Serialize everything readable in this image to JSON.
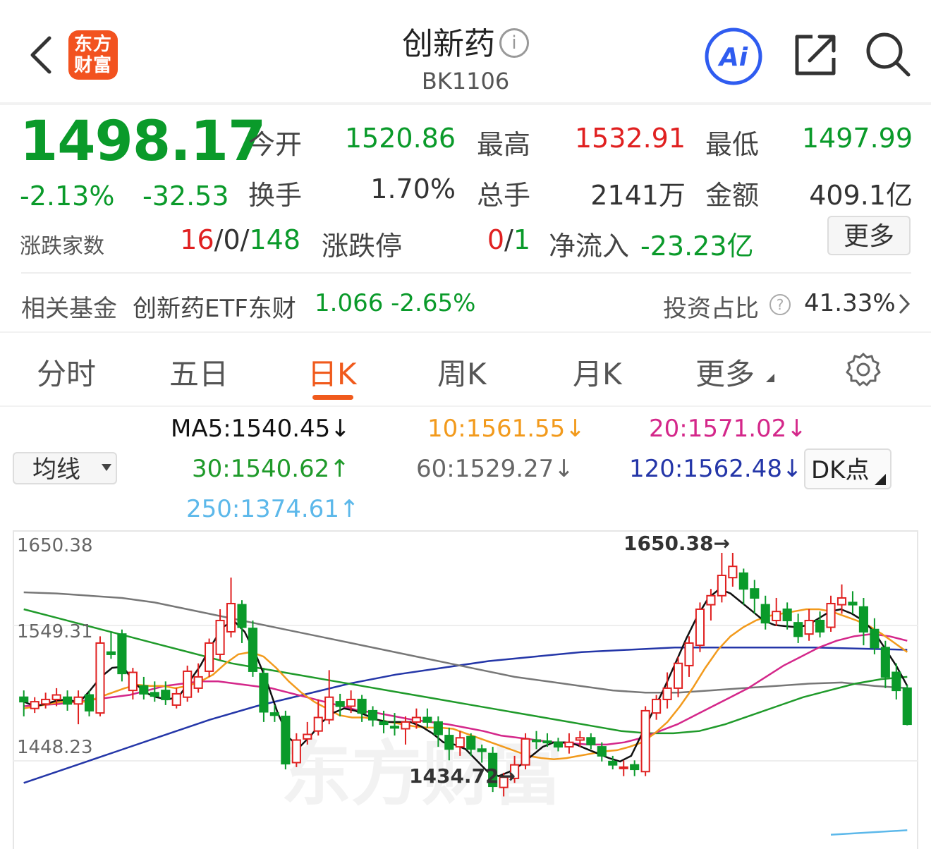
{
  "header": {
    "title": "创新药",
    "code": "BK1106",
    "logo_line1": "东方",
    "logo_line2": "财富",
    "info_glyph": "i",
    "ai_label": "Ai"
  },
  "quote": {
    "price": "1498.17",
    "change_pct": "-2.13%",
    "change": "-32.53",
    "open_label": "今开",
    "open": "1520.86",
    "high_label": "最高",
    "high": "1532.91",
    "low_label": "最低",
    "low": "1497.99",
    "turnover_label": "换手",
    "turnover": "1.70%",
    "volume_label": "总手",
    "volume": "2141万",
    "amount_label": "金额",
    "amount": "409.1亿",
    "breadth_label": "涨跌家数",
    "breadth_up": "16",
    "breadth_flat": "0",
    "breadth_down": "148",
    "limit_label": "涨跌停",
    "limit_up": "0",
    "limit_down": "1",
    "netflow_label": "净流入",
    "netflow": "-23.23亿",
    "more_label": "更多"
  },
  "fund": {
    "label": "相关基金",
    "name": "创新药ETF东财",
    "price": "1.066",
    "change": "-2.65%",
    "ratio_label": "投资占比",
    "ratio": "41.33%"
  },
  "tabs": [
    {
      "label": "分时"
    },
    {
      "label": "五日"
    },
    {
      "label": "日K"
    },
    {
      "label": "周K"
    },
    {
      "label": "月K"
    },
    {
      "label": "更多"
    }
  ],
  "ma": {
    "ma5": "MA5:1540.45↓",
    "ma10": "10:1561.55↓",
    "ma20": "20:1571.02↓",
    "ma30": "30:1540.62↑",
    "ma60": "60:1529.27↓",
    "ma120": "120:1562.48↓",
    "ma250": "250:1374.61↑",
    "select_label": "均线",
    "dk_label": "DK点"
  },
  "colors": {
    "up": "#e02020",
    "down": "#0a9a2a",
    "ma5": "#111111",
    "ma10": "#f29a1c",
    "ma20": "#d4278a",
    "ma30": "#1f9a2a",
    "ma60": "#777777",
    "ma120": "#2436a8",
    "ma250": "#5cb8ea",
    "accent": "#f05a1c"
  },
  "chart_data": {
    "type": "candlestick",
    "y_ticks": [
      "1650.38",
      "1549.31",
      "1448.23"
    ],
    "ylim": [
      1400,
      1660
    ],
    "max_label": "1650.38→",
    "min_label": "1434.72→",
    "watermark": "东方财富",
    "candles": [
      [
        1522,
        1518,
        1528,
        1505
      ],
      [
        1512,
        1518,
        1522,
        1508
      ],
      [
        1516,
        1520,
        1526,
        1512
      ],
      [
        1520,
        1524,
        1530,
        1514
      ],
      [
        1522,
        1516,
        1528,
        1510
      ],
      [
        1516,
        1522,
        1528,
        1498
      ],
      [
        1524,
        1510,
        1528,
        1505
      ],
      [
        1508,
        1570,
        1576,
        1505
      ],
      [
        1562,
        1560,
        1580,
        1556
      ],
      [
        1578,
        1543,
        1582,
        1536
      ],
      [
        1528,
        1544,
        1548,
        1520
      ],
      [
        1532,
        1525,
        1540,
        1520
      ],
      [
        1526,
        1523,
        1536,
        1518
      ],
      [
        1528,
        1520,
        1536,
        1515
      ],
      [
        1515,
        1525,
        1530,
        1512
      ],
      [
        1522,
        1545,
        1550,
        1518
      ],
      [
        1530,
        1540,
        1552,
        1526
      ],
      [
        1545,
        1570,
        1574,
        1540
      ],
      [
        1560,
        1590,
        1600,
        1555
      ],
      [
        1580,
        1605,
        1628,
        1575
      ],
      [
        1604,
        1584,
        1608,
        1570
      ],
      [
        1583,
        1545,
        1590,
        1540
      ],
      [
        1543,
        1509,
        1548,
        1500
      ],
      [
        1508,
        1506,
        1515,
        1500
      ],
      [
        1505,
        1463,
        1510,
        1458
      ],
      [
        1464,
        1484,
        1490,
        1460
      ],
      [
        1485,
        1489,
        1500,
        1480
      ],
      [
        1492,
        1504,
        1520,
        1488
      ],
      [
        1502,
        1522,
        1546,
        1498
      ],
      [
        1518,
        1514,
        1525,
        1505
      ],
      [
        1514,
        1520,
        1528,
        1508
      ],
      [
        1520,
        1508,
        1524,
        1500
      ],
      [
        1510,
        1502,
        1514,
        1496
      ],
      [
        1500,
        1498,
        1510,
        1490
      ],
      [
        1496,
        1495,
        1508,
        1488
      ],
      [
        1494,
        1500,
        1505,
        1480
      ],
      [
        1500,
        1504,
        1512,
        1494
      ],
      [
        1504,
        1500,
        1512,
        1495
      ],
      [
        1500,
        1489,
        1505,
        1478
      ],
      [
        1488,
        1476,
        1495,
        1466
      ],
      [
        1478,
        1486,
        1492,
        1470
      ],
      [
        1487,
        1476,
        1490,
        1470
      ],
      [
        1476,
        1474,
        1480,
        1464
      ],
      [
        1472,
        1443,
        1478,
        1438
      ],
      [
        1442,
        1451,
        1455,
        1434
      ],
      [
        1450,
        1462,
        1470,
        1446
      ],
      [
        1462,
        1485,
        1490,
        1458
      ],
      [
        1484,
        1483,
        1492,
        1476
      ],
      [
        1483,
        1482,
        1490,
        1478
      ],
      [
        1482,
        1478,
        1486,
        1474
      ],
      [
        1478,
        1482,
        1490,
        1472
      ],
      [
        1484,
        1486,
        1492,
        1478
      ],
      [
        1486,
        1480,
        1490,
        1476
      ],
      [
        1478,
        1470,
        1482,
        1465
      ],
      [
        1465,
        1462,
        1470,
        1458
      ],
      [
        1460,
        1460,
        1466,
        1452
      ],
      [
        1462,
        1458,
        1466,
        1452
      ],
      [
        1456,
        1510,
        1514,
        1452
      ],
      [
        1508,
        1520,
        1524,
        1502
      ],
      [
        1520,
        1530,
        1544,
        1512
      ],
      [
        1530,
        1552,
        1558,
        1522
      ],
      [
        1550,
        1570,
        1576,
        1540
      ],
      [
        1568,
        1600,
        1606,
        1562
      ],
      [
        1604,
        1612,
        1618,
        1590
      ],
      [
        1612,
        1630,
        1650,
        1606
      ],
      [
        1628,
        1638,
        1650,
        1620
      ],
      [
        1632,
        1618,
        1636,
        1604
      ],
      [
        1618,
        1610,
        1626,
        1596
      ],
      [
        1604,
        1588,
        1612,
        1582
      ],
      [
        1590,
        1598,
        1610,
        1585
      ],
      [
        1600,
        1590,
        1606,
        1582
      ],
      [
        1588,
        1576,
        1596,
        1570
      ],
      [
        1578,
        1590,
        1600,
        1572
      ],
      [
        1590,
        1580,
        1598,
        1575
      ],
      [
        1584,
        1605,
        1612,
        1580
      ],
      [
        1604,
        1610,
        1622,
        1596
      ],
      [
        1606,
        1604,
        1616,
        1596
      ],
      [
        1602,
        1580,
        1610,
        1568
      ],
      [
        1582,
        1566,
        1592,
        1560
      ],
      [
        1566,
        1540,
        1572,
        1530
      ],
      [
        1544,
        1528,
        1552,
        1520
      ],
      [
        1530,
        1498,
        1533,
        1497
      ]
    ],
    "ma5": [
      1518,
      1514,
      1516,
      1519,
      1520,
      1517,
      1528,
      1540,
      1548,
      1549,
      1535,
      1526,
      1522,
      1520,
      1522,
      1536,
      1550,
      1568,
      1584,
      1590,
      1580,
      1560,
      1536,
      1508,
      1486,
      1478,
      1488,
      1500,
      1508,
      1512,
      1510,
      1506,
      1502,
      1500,
      1500,
      1500,
      1496,
      1490,
      1482,
      1480,
      1476,
      1466,
      1456,
      1452,
      1456,
      1462,
      1470,
      1478,
      1482,
      1482,
      1480,
      1476,
      1472,
      1468,
      1465,
      1470,
      1490,
      1510,
      1530,
      1552,
      1574,
      1594,
      1610,
      1618,
      1614,
      1606,
      1598,
      1590,
      1586,
      1585,
      1584,
      1586,
      1592,
      1598,
      1600,
      1596,
      1590,
      1580,
      1565,
      1550,
      1532
    ],
    "ma10": [
      1512,
      1514,
      1516,
      1518,
      1518,
      1518,
      1522,
      1526,
      1530,
      1533,
      1532,
      1532,
      1530,
      1532,
      1536,
      1542,
      1552,
      1560,
      1562,
      1558,
      1548,
      1536,
      1526,
      1518,
      1512,
      1506,
      1504,
      1504,
      1502,
      1500,
      1498,
      1496,
      1495,
      1495,
      1494,
      1490,
      1486,
      1482,
      1478,
      1474,
      1470,
      1468,
      1467,
      1468,
      1470,
      1472,
      1474,
      1475,
      1478,
      1482,
      1490,
      1500,
      1514,
      1530,
      1548,
      1564,
      1576,
      1584,
      1590,
      1594,
      1596,
      1598,
      1600,
      1600,
      1598,
      1594,
      1590,
      1585,
      1578,
      1570,
      1562
    ],
    "ma20": [
      1514,
      1515,
      1516,
      1518,
      1520,
      1522,
      1524,
      1528,
      1532,
      1534,
      1536,
      1536,
      1534,
      1532,
      1530,
      1526,
      1522,
      1518,
      1514,
      1510,
      1508,
      1505,
      1502,
      1500,
      1498,
      1495,
      1492,
      1488,
      1486,
      1484,
      1482,
      1481,
      1480,
      1480,
      1482,
      1486,
      1492,
      1498,
      1506,
      1514,
      1522,
      1530,
      1540,
      1550,
      1558,
      1566,
      1572,
      1576,
      1578,
      1576,
      1572
    ],
    "ma30": [
      1600,
      1594,
      1588,
      1582,
      1576,
      1570,
      1564,
      1558,
      1552,
      1548,
      1544,
      1540,
      1536,
      1532,
      1528,
      1524,
      1520,
      1516,
      1512,
      1508,
      1504,
      1500,
      1496,
      1492,
      1490,
      1490,
      1492,
      1498,
      1506,
      1514,
      1522,
      1528,
      1534,
      1538,
      1540
    ],
    "ma60": [
      1615,
      1614,
      1612,
      1610,
      1606,
      1600,
      1594,
      1588,
      1582,
      1576,
      1570,
      1564,
      1558,
      1552,
      1546,
      1540,
      1536,
      1532,
      1528,
      1526,
      1526,
      1528,
      1530,
      1532,
      1534,
      1535,
      1532,
      1530
    ],
    "ma120": [
      1446,
      1460,
      1474,
      1488,
      1502,
      1514,
      1524,
      1534,
      1542,
      1548,
      1554,
      1558,
      1562,
      1564,
      1566,
      1566,
      1566,
      1566,
      1565,
      1564
    ],
    "ma250": [
      1400,
      1404
    ]
  }
}
